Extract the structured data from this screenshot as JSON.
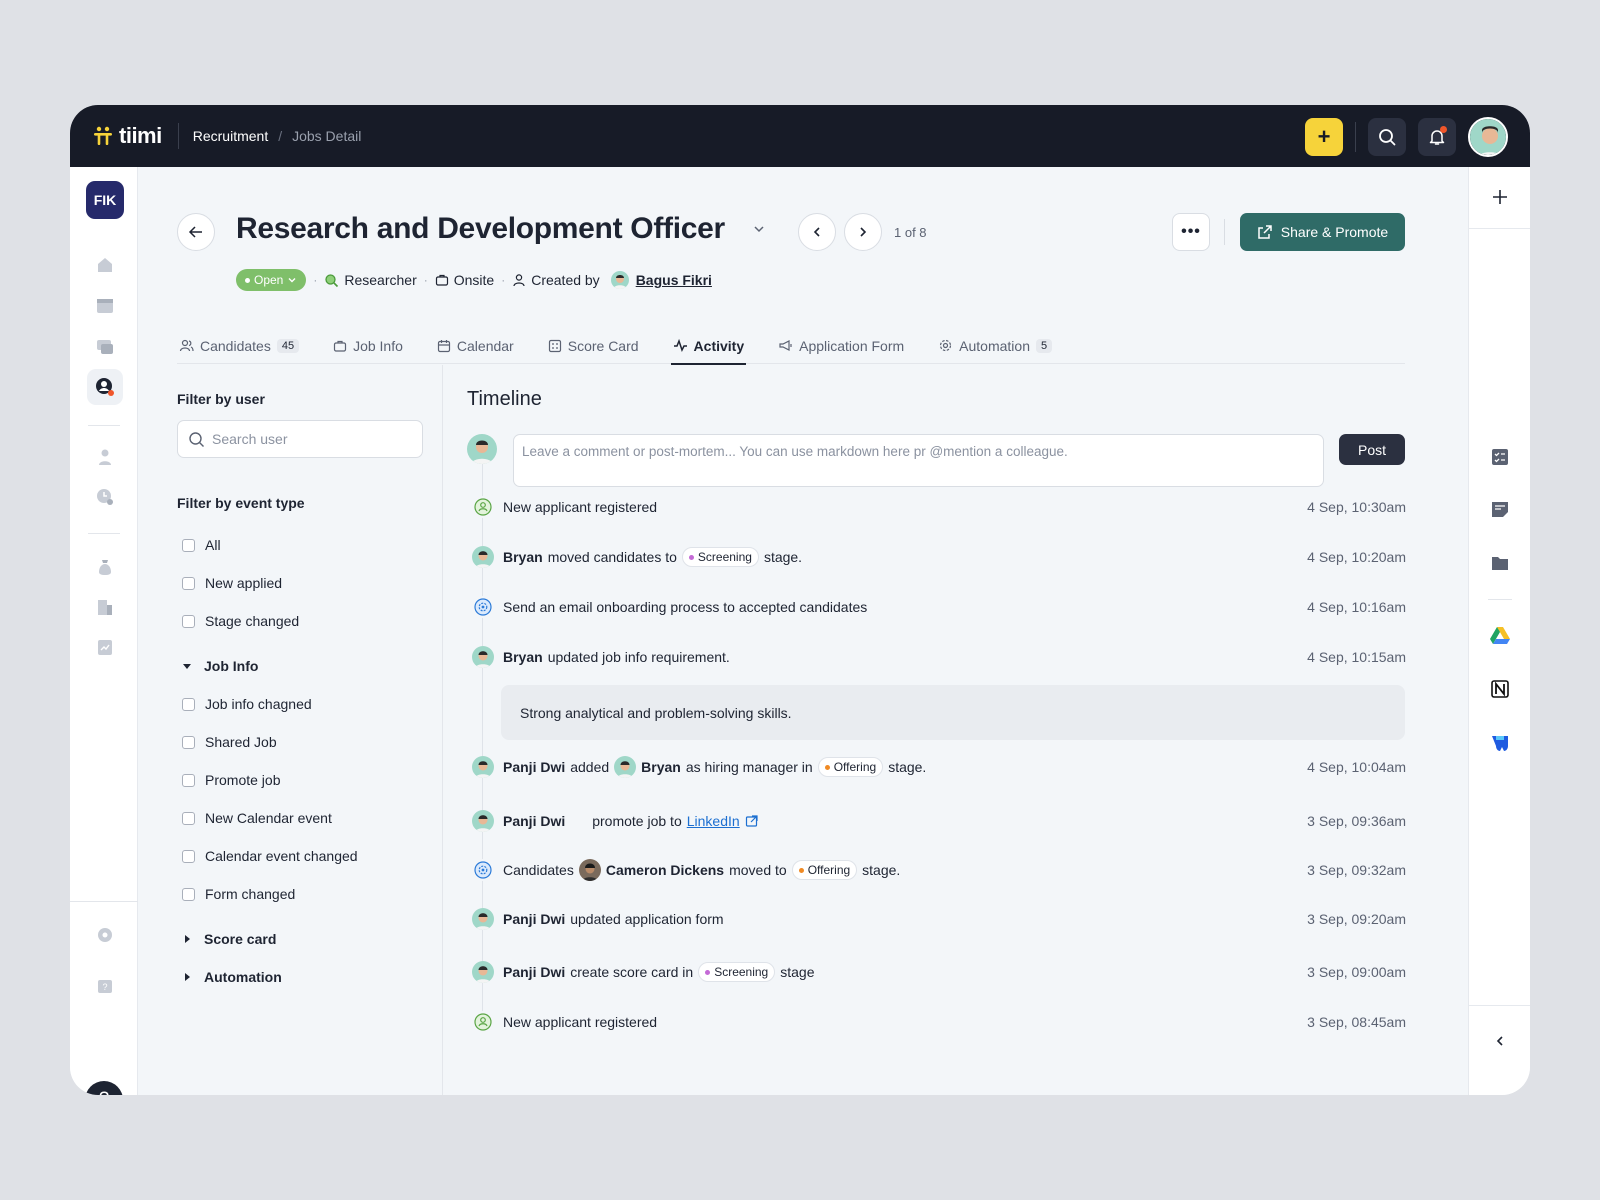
{
  "app": {
    "name": "tiimi",
    "workspace": "FIK"
  },
  "breadcrumb": {
    "root": "Recruitment",
    "separator": "/",
    "current": "Jobs Detail"
  },
  "header": {
    "title": "Research and Development Officer",
    "pager": "1 of 8",
    "share_label": "Share & Promote",
    "more_label": "•••",
    "add_label": "+"
  },
  "meta": {
    "status": "Open",
    "role": "Researcher",
    "location": "Onsite",
    "created_by_label": "Created by",
    "creator": "Bagus Fikri",
    "sep": "·"
  },
  "tabs": [
    {
      "label": "Candidates",
      "count": "45"
    },
    {
      "label": "Job Info"
    },
    {
      "label": "Calendar"
    },
    {
      "label": "Score Card"
    },
    {
      "label": "Activity",
      "active": true
    },
    {
      "label": "Application Form"
    },
    {
      "label": "Automation",
      "count": "5"
    }
  ],
  "filters": {
    "by_user_title": "Filter by user",
    "search_placeholder": "Search user",
    "by_event_title": "Filter by event type",
    "items": [
      "All",
      "New applied",
      "Stage changed"
    ],
    "job_info_group": "Job Info",
    "job_info_items": [
      "Job info chagned",
      "Shared Job",
      "Promote job",
      "New Calendar event",
      "Calendar event changed",
      "Form changed"
    ],
    "score_card_group": "Score card",
    "automation_group": "Automation"
  },
  "timeline": {
    "title": "Timeline",
    "comment_placeholder": "Leave a comment or post-mortem... You can use markdown here pr @mention a colleague.",
    "post_label": "Post",
    "events": [
      {
        "text": "New applicant registered",
        "time": "4 Sep, 10:30am"
      },
      {
        "user": "Bryan",
        "text": "moved candidates to",
        "stage": "Screening",
        "tail": "stage.",
        "time": "4 Sep, 10:20am"
      },
      {
        "text": "Send an email onboarding process to accepted candidates",
        "time": "4 Sep, 10:16am"
      },
      {
        "user": "Bryan",
        "text": "updated job info requirement.",
        "time": "4 Sep, 10:15am",
        "note": "Strong analytical and problem-solving skills."
      },
      {
        "user": "Panji Dwi",
        "text": "added",
        "user2": "Bryan",
        "text2": "as hiring manager in",
        "stage": "Offering",
        "tail": "stage.",
        "time": "4 Sep, 10:04am"
      },
      {
        "user": "Panji Dwi",
        "text": "promote job to",
        "link": "LinkedIn",
        "time": "3 Sep, 09:36am"
      },
      {
        "text": "Candidates",
        "user2": "Cameron Dickens",
        "text2": "moved to",
        "stage": "Offering",
        "tail": "stage.",
        "time": "3 Sep, 09:32am"
      },
      {
        "user": "Panji Dwi",
        "text": "updated application form",
        "time": "3 Sep, 09:20am"
      },
      {
        "user": "Panji Dwi",
        "text": "create score card in",
        "stage": "Screening",
        "tail": "stage",
        "time": "3 Sep, 09:00am"
      },
      {
        "text": "New applicant registered",
        "time": "3 Sep, 08:45am"
      }
    ]
  },
  "colors": {
    "accent": "#2f6b67",
    "topbar": "#171b27",
    "yellow": "#f6d33a",
    "open": "#7fbf6a",
    "screening": "#c46ad6",
    "offering": "#f08a24"
  },
  "help_label": "?"
}
